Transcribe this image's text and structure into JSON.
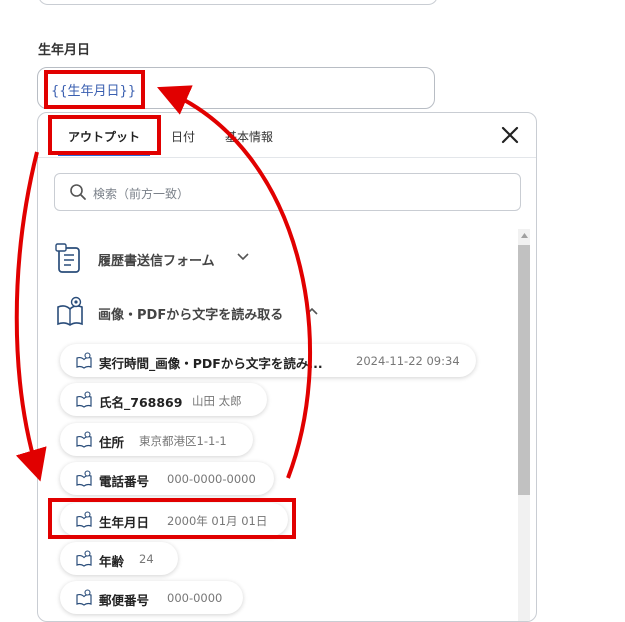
{
  "field": {
    "label": "生年月日",
    "value": "{{生年月日}}"
  },
  "tabs": [
    {
      "label": "アウトプット"
    },
    {
      "label": "日付"
    },
    {
      "label": "基本情報"
    }
  ],
  "search": {
    "placeholder": "検索（前方一致）"
  },
  "groups": [
    {
      "label": "履歴書送信フォーム",
      "expanded": false,
      "icon": "form-icon"
    },
    {
      "label": "画像・PDFから文字を読み取る",
      "expanded": true,
      "icon": "book-ocr-icon"
    }
  ],
  "outputs": [
    {
      "name": "実行時間_画像・PDFから文字を読み...",
      "value": "2024-11-22 09:34"
    },
    {
      "name": "氏名_768869",
      "value": "山田 太郎"
    },
    {
      "name": "住所",
      "value": "東京都港区1-1-1"
    },
    {
      "name": "電話番号",
      "value": "000-0000-0000"
    },
    {
      "name": "生年月日",
      "value": "2000年 01月 01日"
    },
    {
      "name": "年齢",
      "value": "24"
    },
    {
      "name": "郵便番号",
      "value": "000-0000"
    }
  ],
  "colors": {
    "accent": "#2e6ad9",
    "annotation": "#e10000"
  }
}
